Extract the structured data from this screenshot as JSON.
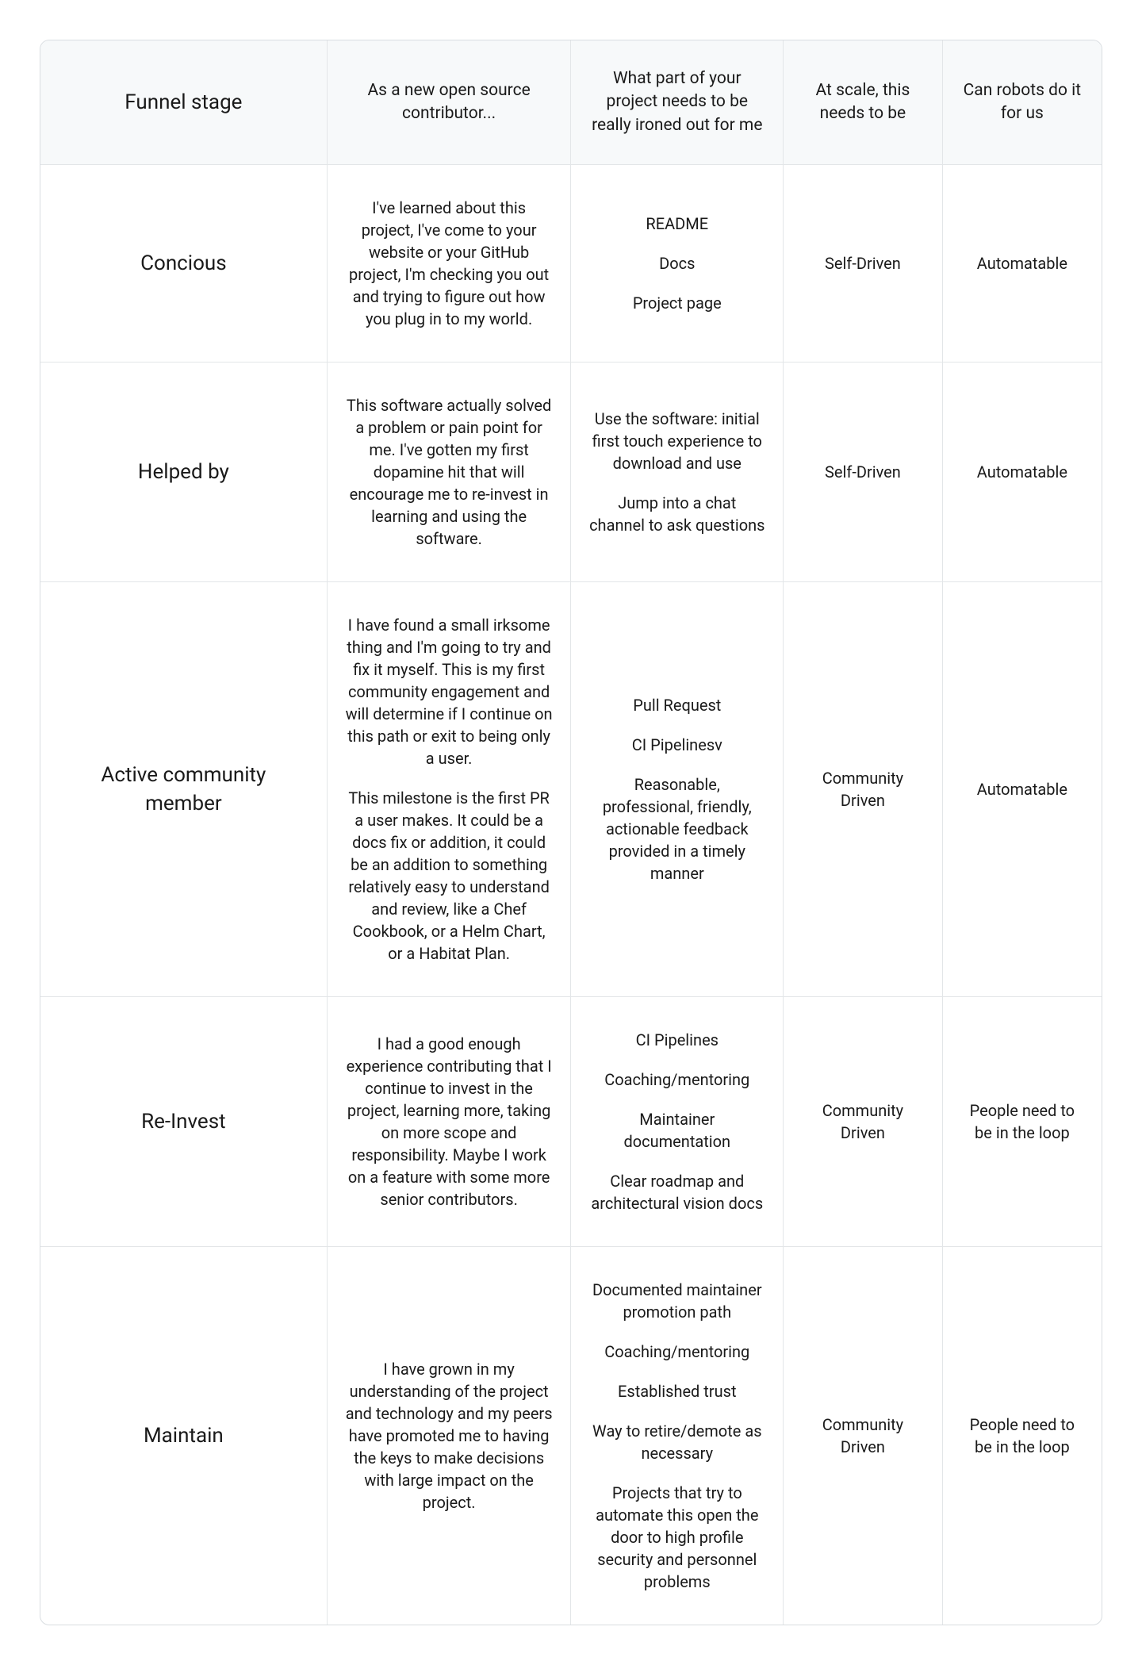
{
  "headers": {
    "col1": "Funnel stage",
    "col2": "As a new open source contributor...",
    "col3": "What part of your project needs to be really ironed out for me",
    "col4": "At scale, this needs to be",
    "col5": "Can robots do it for us"
  },
  "rows": [
    {
      "stage": "Concious",
      "contributor": [
        "I've learned about this project, I've come to your website or your GitHub project, I'm checking you out and trying to figure out how you plug in to my world."
      ],
      "ironed": [
        "README",
        "Docs",
        "Project page"
      ],
      "scale": "Self-Driven",
      "robots": "Automatable"
    },
    {
      "stage": "Helped by",
      "contributor": [
        "This software actually solved a problem or pain point for me. I've gotten my first dopamine hit that will encourage me to re-invest in learning and using the software."
      ],
      "ironed": [
        "Use the software: initial first touch experience to download and use",
        "Jump into a chat channel to ask questions"
      ],
      "scale": "Self-Driven",
      "robots": "Automatable"
    },
    {
      "stage": "Active community member",
      "contributor": [
        "I have found a small irksome thing and I'm going to try and fix it myself. This is my first community engagement and will determine if I continue on this path or exit to being only a user.",
        "This milestone is the first PR a user makes. It could be a docs fix or addition, it could be an addition to something relatively easy to understand and review, like a Chef Cookbook, or a Helm Chart, or a Habitat Plan."
      ],
      "ironed": [
        "Pull Request",
        "CI Pipelinesv",
        "Reasonable, professional, friendly, actionable feedback provided in a timely manner"
      ],
      "scale": "Community Driven",
      "robots": "Automatable"
    },
    {
      "stage": "Re-Invest",
      "contributor": [
        "I had a good enough experience contributing that I continue to invest in the project, learning more, taking on more scope and responsibility. Maybe I work on a feature with some more senior contributors."
      ],
      "ironed": [
        "CI Pipelines",
        "Coaching/mentoring",
        "Maintainer documentation",
        "Clear roadmap and architectural vision docs"
      ],
      "scale": "Community Driven",
      "robots": "People need to be in the loop"
    },
    {
      "stage": "Maintain",
      "contributor": [
        "I have grown in my understanding of the project and technology and my peers have promoted me to having the keys to make decisions with large impact on the project."
      ],
      "ironed": [
        "Documented maintainer promotion path",
        "Coaching/mentoring",
        "Established trust",
        "Way to retire/demote as necessary",
        "Projects that try to automate this open the door to high profile security and personnel problems"
      ],
      "scale": "Community Driven",
      "robots": "People need to be in the loop"
    }
  ]
}
